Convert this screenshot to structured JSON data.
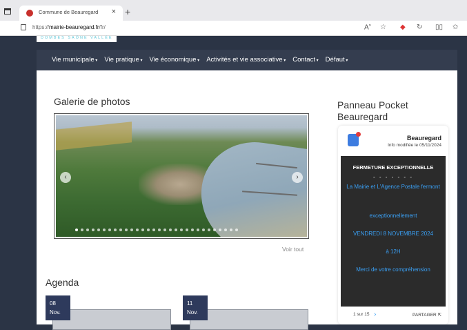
{
  "browser": {
    "tab_title": "Commune de Beauregard",
    "tab_close": "×",
    "new_tab": "+",
    "url_prefix": "https://",
    "url_host": "mairie-beauregard.fr",
    "url_path": "/fr/",
    "toolbar_icons": [
      "read-aloud-icon",
      "favorite-star-icon",
      "extension-icon",
      "refresh-icon",
      "split-screen-icon",
      "favorites-icon"
    ]
  },
  "site": {
    "logo_text": "DOMBES SAÔNE VALLÉE",
    "nav": [
      {
        "label": "Vie municipale"
      },
      {
        "label": "Vie pratique"
      },
      {
        "label": "Vie économique"
      },
      {
        "label": "Activités et vie associative"
      },
      {
        "label": "Contact"
      },
      {
        "label": "Défaut"
      }
    ]
  },
  "gallery": {
    "title": "Galerie de photos",
    "see_all": "Voir tout",
    "dot_count": 30
  },
  "agenda": {
    "title": "Agenda",
    "events": [
      {
        "day": "08",
        "month": "Nov."
      },
      {
        "day": "11",
        "month": "Nov."
      }
    ]
  },
  "panneau": {
    "title": "Panneau Pocket Beauregard",
    "name": "Beauregard",
    "modified": "Info modifiée le 05/11/2024",
    "lines": [
      {
        "text": "FERMETURE EXCEPTIONNELLE",
        "style": "head"
      },
      {
        "text": "- - - - - - -",
        "style": "dashes"
      },
      {
        "text": "La Mairie et L'Agence Postale fermont",
        "style": "blue"
      },
      {
        "text": "exceptionnellement",
        "style": "blue"
      },
      {
        "text": "VENDREDI 8 NOVEMBRE 2024",
        "style": "blue"
      },
      {
        "text": "à 12H",
        "style": "blue"
      },
      {
        "text": "Merci de votre compréhension",
        "style": "blue"
      }
    ],
    "pager": "1 sur 15",
    "next": "›",
    "share": "PARTAGER"
  },
  "colors": {
    "navbar": "#343d4f",
    "background": "#2b3445",
    "accent_blue": "#3aa0f5",
    "date_badge": "#2e3a5c"
  }
}
